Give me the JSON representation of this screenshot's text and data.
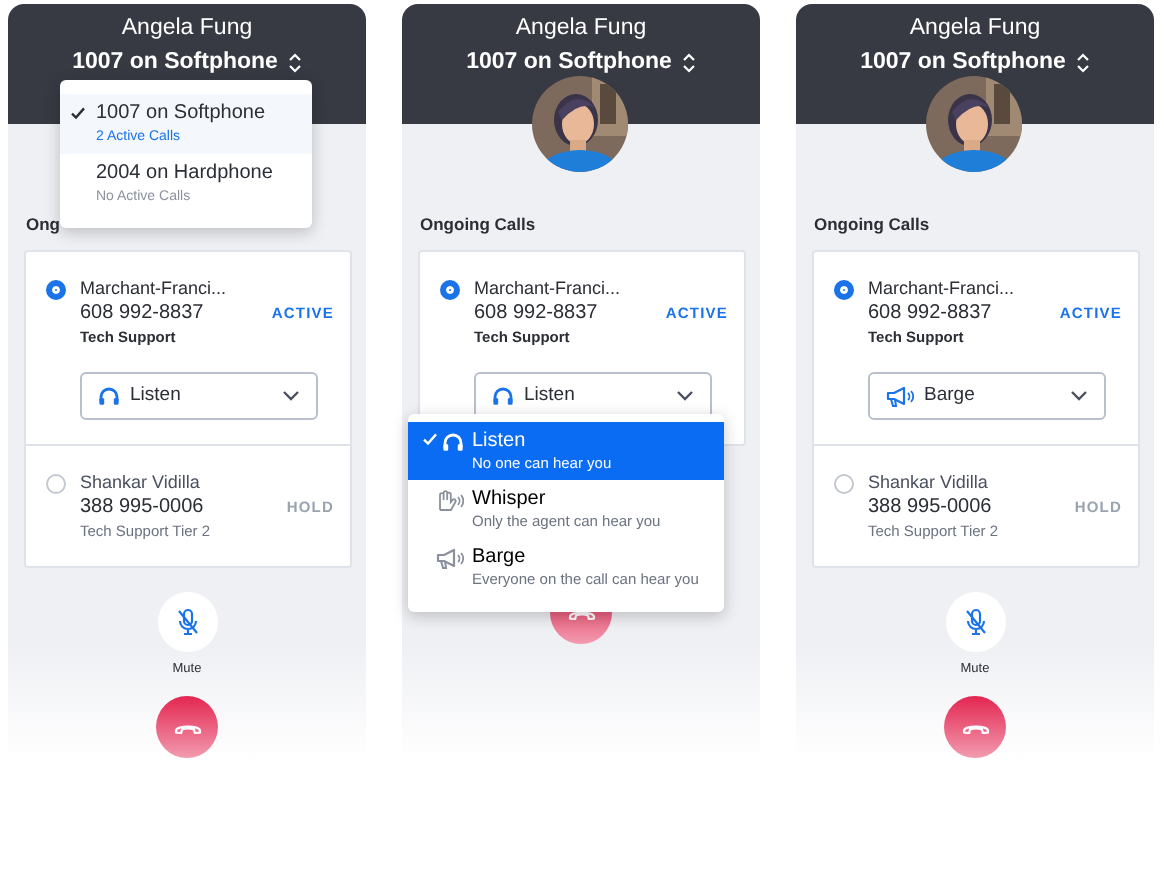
{
  "panels": [
    {
      "user_name": "Angela Fung",
      "device": "1007 on Softphone",
      "section_label": "Ong",
      "device_menu": [
        {
          "label": "1007 on Softphone",
          "status": "2 Active Calls",
          "selected": true
        },
        {
          "label": "2004 on Hardphone",
          "status": "No Active Calls",
          "selected": false
        }
      ],
      "calls": [
        {
          "name": "Marchant-Franci...",
          "number": "608 992-8837",
          "group": "Tech Support",
          "status": "ACTIVE",
          "selected": true,
          "mode": {
            "kind": "listen",
            "label": "Listen"
          }
        },
        {
          "name": "Shankar Vidilla",
          "number": "388 995-0006",
          "group": "Tech Support Tier 2",
          "status": "HOLD",
          "selected": false
        }
      ],
      "mute_label": "Mute"
    },
    {
      "user_name": "Angela Fung",
      "device": "1007 on Softphone",
      "avatar": {
        "kind": "picture"
      },
      "section_label": "Ongoing Calls",
      "calls": [
        {
          "name": "Marchant-Franci...",
          "number": "608 992-8837",
          "group": "Tech Support",
          "status": "ACTIVE",
          "selected": true,
          "mode": {
            "kind": "listen",
            "label": "Listen"
          }
        }
      ],
      "mode_menu": [
        {
          "kind": "listen",
          "label": "Listen",
          "hint": "No one can hear you",
          "selected": true
        },
        {
          "kind": "whisper",
          "label": "Whisper",
          "hint": "Only the agent can hear you",
          "selected": false
        },
        {
          "kind": "barge",
          "label": "Barge",
          "hint": "Everyone on the call can hear you",
          "selected": false
        }
      ]
    },
    {
      "user_name": "Angela Fung",
      "device": "1007 on Softphone",
      "avatar": {
        "kind": "picture"
      },
      "section_label": "Ongoing Calls",
      "calls": [
        {
          "name": "Marchant-Franci...",
          "number": "608 992-8837",
          "group": "Tech Support",
          "status": "ACTIVE",
          "selected": true,
          "mode": {
            "kind": "barge",
            "label": "Barge"
          }
        },
        {
          "name": "Shankar Vidilla",
          "number": "388 995-0006",
          "group": "Tech Support Tier 2",
          "status": "HOLD",
          "selected": false
        }
      ],
      "mute_label": "Mute"
    }
  ]
}
